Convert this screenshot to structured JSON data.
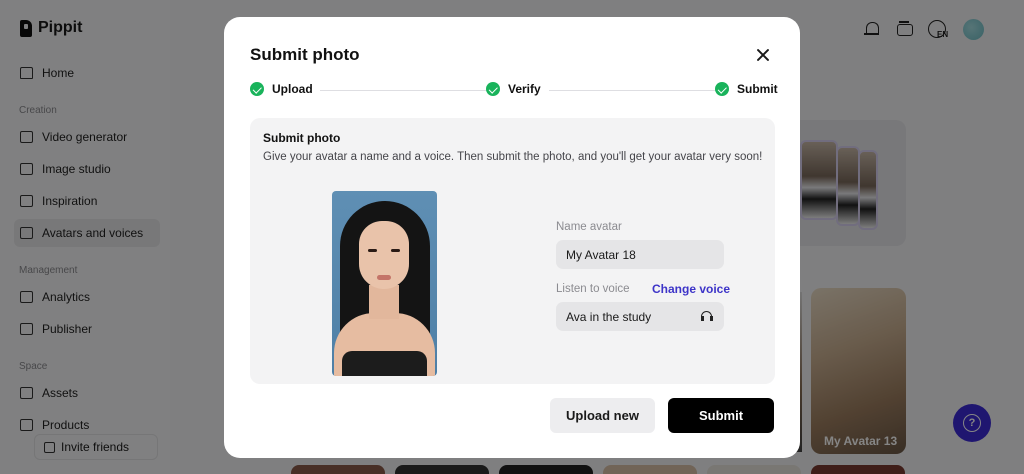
{
  "app": {
    "logo": "Pippit",
    "language": "EN"
  },
  "sidebar": {
    "home": "Home",
    "sections": {
      "creation": "Creation",
      "management": "Management",
      "space": "Space"
    },
    "creation_items": [
      "Video generator",
      "Image studio",
      "Inspiration",
      "Avatars and voices"
    ],
    "management_items": [
      "Analytics",
      "Publisher"
    ],
    "space_items": [
      "Assets",
      "Products"
    ],
    "active_item": "Avatars and voices",
    "invite": "Invite friends"
  },
  "background": {
    "avatar_card_label": "My Avatar 13"
  },
  "modal": {
    "title": "Submit photo",
    "steps": [
      "Upload",
      "Verify",
      "Submit"
    ],
    "panel": {
      "title": "Submit photo",
      "description": "Give your avatar a name and a voice. Then submit the photo, and you'll get your avatar very soon!"
    },
    "name_label": "Name avatar",
    "name_value": "My Avatar 18",
    "voice_label": "Listen to voice",
    "change_voice": "Change voice",
    "voice_value": "Ava in the study",
    "upload_new": "Upload new",
    "submit": "Submit"
  },
  "colors": {
    "accent": "#3d34c8",
    "success": "#19b35b",
    "primary_button": "#000000",
    "help_button": "#3d2bd6"
  },
  "icons": {
    "close": "close-icon",
    "step": "check-icon",
    "voice": "headphones-icon"
  }
}
